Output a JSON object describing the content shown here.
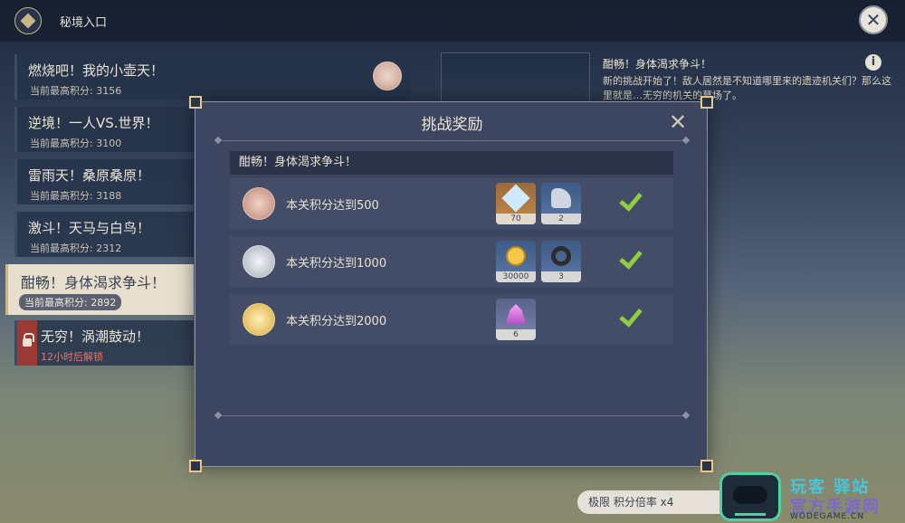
{
  "header": {
    "title": "秘境入口"
  },
  "domains": [
    {
      "name": "燃烧吧！我的小壶天！",
      "score": "当前最高积分: 3156"
    },
    {
      "name": "逆境！一人VS.世界！",
      "score": "当前最高积分: 3100"
    },
    {
      "name": "雷雨天！桑原桑原！",
      "score": "当前最高积分: 3188"
    },
    {
      "name": "激斗！天马与白鸟！",
      "score": "当前最高积分: 2312"
    },
    {
      "name": "酣畅！身体渴求争斗！",
      "score": "当前最高积分: 2892"
    },
    {
      "name": "无穷！涡潮鼓动！",
      "score": "12小时后解锁"
    }
  ],
  "detail": {
    "title": "酣畅！身体渴求争斗！",
    "description": "新的挑战开始了！敌人居然是不知道哪里来的遗迹机关们？那么这里就是…无穷的机关的墓场了。"
  },
  "modal": {
    "title": "挑战奖励",
    "section": "酣畅！身体渴求争斗！",
    "tiers": [
      {
        "requirement": "本关积分达到500",
        "rewards": [
          {
            "icon": "primogem-icon",
            "count": "70"
          },
          {
            "icon": "horn-material-icon",
            "count": "2"
          }
        ]
      },
      {
        "requirement": "本关积分达到1000",
        "rewards": [
          {
            "icon": "mora-icon",
            "count": "30000"
          },
          {
            "icon": "chaos-circuit-icon",
            "count": "3"
          }
        ]
      },
      {
        "requirement": "本关积分达到2000",
        "rewards": [
          {
            "icon": "crystal-icon",
            "count": "6"
          }
        ]
      }
    ]
  },
  "footer": {
    "multiplier": "极限 积分倍率 x4"
  },
  "watermark": {
    "line1": "玩客",
    "line2": "驿站",
    "line3": "官方手游网",
    "site": "WODEGAME.CN"
  }
}
